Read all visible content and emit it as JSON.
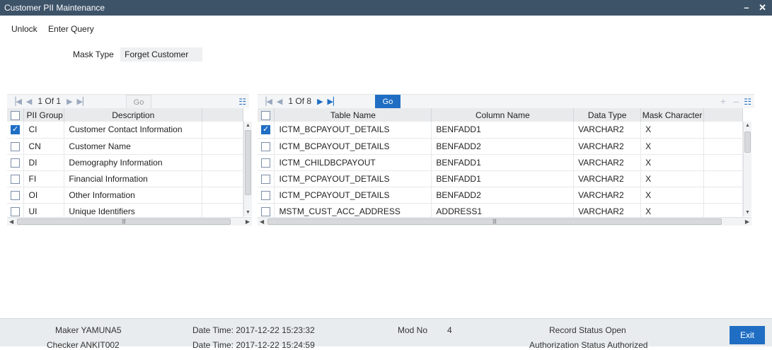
{
  "window": {
    "title": "Customer PII Maintenance",
    "minimize": "–",
    "close": "✕"
  },
  "menu": {
    "unlock": "Unlock",
    "enter_query": "Enter Query"
  },
  "mask_type": {
    "label": "Mask Type",
    "value": "Forget Customer"
  },
  "left_grid": {
    "pager": "1 Of 1",
    "go": "Go",
    "headers": [
      "PII Group",
      "Description"
    ],
    "rows": [
      {
        "checked": true,
        "group": "CI",
        "description": "Customer Contact Information"
      },
      {
        "checked": false,
        "group": "CN",
        "description": "Customer Name"
      },
      {
        "checked": false,
        "group": "DI",
        "description": "Demography Information"
      },
      {
        "checked": false,
        "group": "FI",
        "description": "Financial Information"
      },
      {
        "checked": false,
        "group": "OI",
        "description": "Other Information"
      },
      {
        "checked": false,
        "group": "UI",
        "description": "Unique Identifiers"
      }
    ]
  },
  "right_grid": {
    "pager": "1 Of 8",
    "go": "Go",
    "headers": [
      "Table Name",
      "Column Name",
      "Data Type",
      "Mask Character"
    ],
    "rows": [
      {
        "checked": true,
        "table": "ICTM_BCPAYOUT_DETAILS",
        "column": "BENFADD1",
        "type": "VARCHAR2",
        "mask": "X"
      },
      {
        "checked": false,
        "table": "ICTM_BCPAYOUT_DETAILS",
        "column": "BENFADD2",
        "type": "VARCHAR2",
        "mask": "X"
      },
      {
        "checked": false,
        "table": "ICTM_CHILDBCPAYOUT",
        "column": "BENFADD1",
        "type": "VARCHAR2",
        "mask": "X"
      },
      {
        "checked": false,
        "table": "ICTM_PCPAYOUT_DETAILS",
        "column": "BENFADD1",
        "type": "VARCHAR2",
        "mask": "X"
      },
      {
        "checked": false,
        "table": "ICTM_PCPAYOUT_DETAILS",
        "column": "BENFADD2",
        "type": "VARCHAR2",
        "mask": "X"
      },
      {
        "checked": false,
        "table": "MSTM_CUST_ACC_ADDRESS",
        "column": "ADDRESS1",
        "type": "VARCHAR2",
        "mask": "X"
      }
    ]
  },
  "footer": {
    "maker": "Maker YAMUNA5",
    "checker": "Checker ANKIT002",
    "maker_dt": "Date Time: 2017-12-22 15:23:32",
    "checker_dt": "Date Time: 2017-12-22 15:24:59",
    "mod_label": "Mod No",
    "mod_value": "4",
    "record_status": "Record Status Open",
    "auth_status": "Authorization Status Authorized",
    "exit": "Exit"
  },
  "colors": {
    "title_bar": "#3d5368",
    "accent": "#1f6ec4"
  }
}
